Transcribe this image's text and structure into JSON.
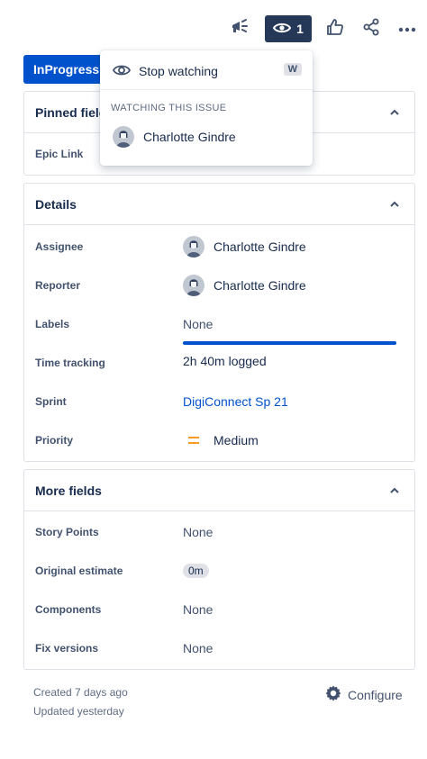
{
  "toolbar": {
    "watch_count": "1",
    "feedback_icon": "megaphone-icon",
    "watch_icon": "eye-icon",
    "like_icon": "thumbs-up-icon",
    "share_icon": "share-icon",
    "more_icon": "more-icon"
  },
  "status": {
    "label": "InProgress"
  },
  "watch_menu": {
    "stop_label": "Stop watching",
    "shortcut": "W",
    "section_title": "WATCHING THIS ISSUE",
    "watcher": "Charlotte Gindre"
  },
  "pinned": {
    "title": "Pinned fields",
    "rows": [
      {
        "label": "Epic Link",
        "value": ""
      }
    ]
  },
  "details": {
    "title": "Details",
    "assignee": {
      "label": "Assignee",
      "value": "Charlotte Gindre"
    },
    "reporter": {
      "label": "Reporter",
      "value": "Charlotte Gindre"
    },
    "labels": {
      "label": "Labels",
      "value": "None"
    },
    "time_tracking": {
      "label": "Time tracking",
      "value": "2h 40m logged",
      "progress": 1.0
    },
    "sprint": {
      "label": "Sprint",
      "value": "DigiConnect Sp 21"
    },
    "priority": {
      "label": "Priority",
      "value": "Medium"
    }
  },
  "more_fields": {
    "title": "More fields",
    "story_points": {
      "label": "Story Points",
      "value": "None"
    },
    "original_estimate": {
      "label": "Original estimate",
      "value": "0m"
    },
    "components": {
      "label": "Components",
      "value": "None"
    },
    "fix_versions": {
      "label": "Fix versions",
      "value": "None"
    }
  },
  "footer": {
    "created": "Created 7 days ago",
    "updated": "Updated yesterday",
    "configure_label": "Configure"
  },
  "colors": {
    "primary": "#0052CC",
    "watch_button": "#253858",
    "priority_medium": "#FF991F"
  }
}
